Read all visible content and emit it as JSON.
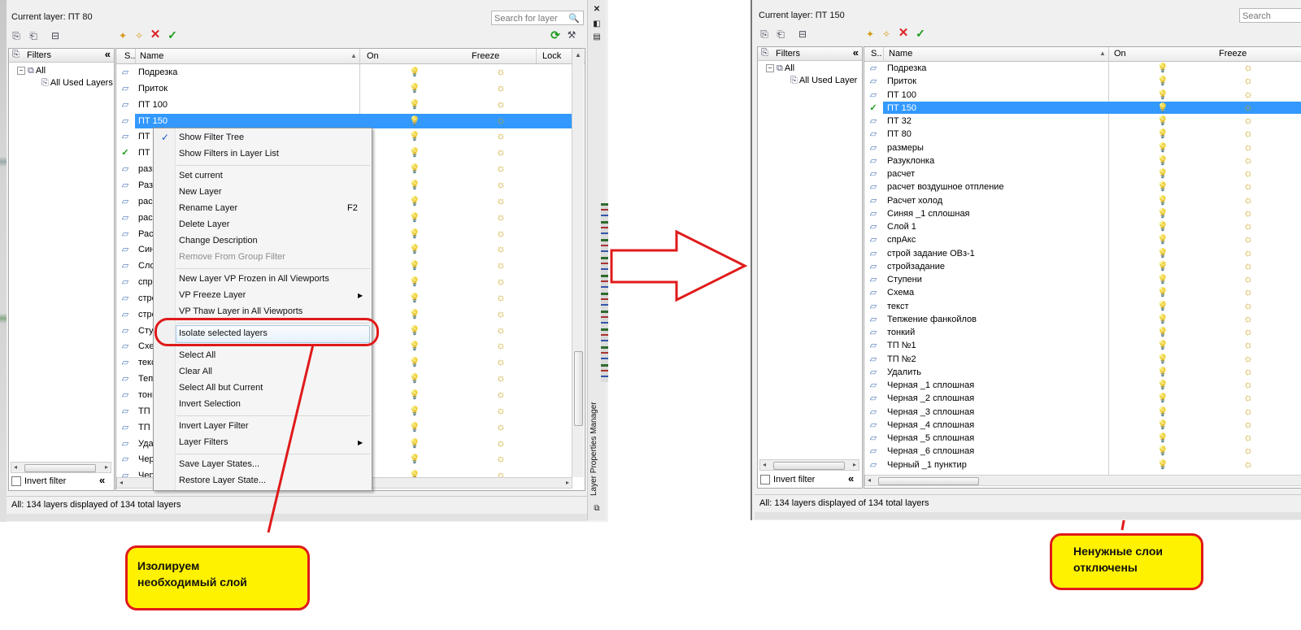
{
  "left": {
    "current_layer": "Current layer: ПТ 80",
    "search_placeholder": "Search for layer",
    "filters_title": "Filters",
    "tree": [
      "All",
      "All Used Layers"
    ],
    "columns": {
      "status": "S..",
      "name": "Name",
      "on": "On",
      "freeze": "Freeze",
      "lock": "Lock"
    },
    "layers": [
      "Подрезка",
      "Приток",
      "ПТ 100",
      "ПТ 150",
      "ПТ 3",
      "ПТ 8",
      "разм",
      "Разу",
      "расч",
      "расч",
      "Расч",
      "Син",
      "Слоі",
      "спр",
      "стро",
      "стро",
      "Сту",
      "Схе",
      "текс",
      "Теп",
      "тонк",
      "ТП М",
      "ТП М",
      "Удал",
      "Чер",
      "Чер"
    ],
    "selected_index": 3,
    "current_index": 5,
    "invert_filter": "Invert filter",
    "status": "All: 134 layers displayed of 134 total layers",
    "side_title": "Layer Properties Manager"
  },
  "context_menu": {
    "items": [
      {
        "label": "Show Filter Tree",
        "checked": true
      },
      {
        "label": "Show Filters in Layer List"
      },
      {
        "label": "Set current"
      },
      {
        "label": "New Layer"
      },
      {
        "label": "Rename Layer",
        "key": "F2"
      },
      {
        "label": "Delete Layer"
      },
      {
        "label": "Change Description"
      },
      {
        "label": "Remove From Group Filter",
        "disabled": true
      },
      {
        "label": "New Layer VP Frozen in All Viewports"
      },
      {
        "label": "VP Freeze Layer",
        "submenu": true
      },
      {
        "label": "VP Thaw Layer in All Viewports"
      },
      {
        "label": "Isolate selected layers",
        "highlighted": true
      },
      {
        "label": "Select All"
      },
      {
        "label": "Clear All"
      },
      {
        "label": "Select All but Current"
      },
      {
        "label": "Invert Selection"
      },
      {
        "label": "Invert Layer Filter"
      },
      {
        "label": "Layer Filters",
        "submenu": true
      },
      {
        "label": "Save Layer States..."
      },
      {
        "label": "Restore Layer State..."
      }
    ]
  },
  "annotations": {
    "left_note": [
      "Изолируем",
      "необходимый слой"
    ],
    "right_note": [
      "Ненужные слои",
      "отключены"
    ]
  },
  "right": {
    "current_layer": "Current layer: ПТ 150",
    "search_placeholder": "Search",
    "filters_title": "Filters",
    "tree": [
      "All",
      "All Used Layer"
    ],
    "columns": {
      "status": "S..",
      "name": "Name",
      "on": "On",
      "freeze": "Freeze"
    },
    "layers": [
      "Подрезка",
      "Приток",
      "ПТ 100",
      "ПТ 150",
      "ПТ 32",
      "ПТ 80",
      "размеры",
      "Разуклонка",
      "расчет",
      "расчет воздушное отпление",
      "Расчет холод",
      "Синяя _1 сплошная",
      "Слой 1",
      "спрАкс",
      "строй задание ОВз-1",
      "стройзадание",
      "Ступени",
      "Схема",
      "текст",
      "Тепжение фанкойлов",
      "тонкий",
      "ТП №1",
      "ТП №2",
      "Удалить",
      "Черная _1 сплошная",
      "Черная _2 сплошная",
      "Черная _3 сплошная",
      "Черная _4 сплошная",
      "Черная _5 сплошная",
      "Черная _6 сплошная",
      "Черный _1 пунктир"
    ],
    "selected_index": 3,
    "invert_filter": "Invert filter",
    "status": "All: 134 layers displayed of 134 total layers"
  },
  "colors": {
    "selection": "#3399ff",
    "annotation_fill": "#fff200",
    "annotation_border": "#e01a1a"
  },
  "icons": {
    "layer": "layer-parallelogram-icon",
    "on": "lightbulb-icon",
    "freeze": "sun-icon",
    "current": "green-check-icon"
  }
}
